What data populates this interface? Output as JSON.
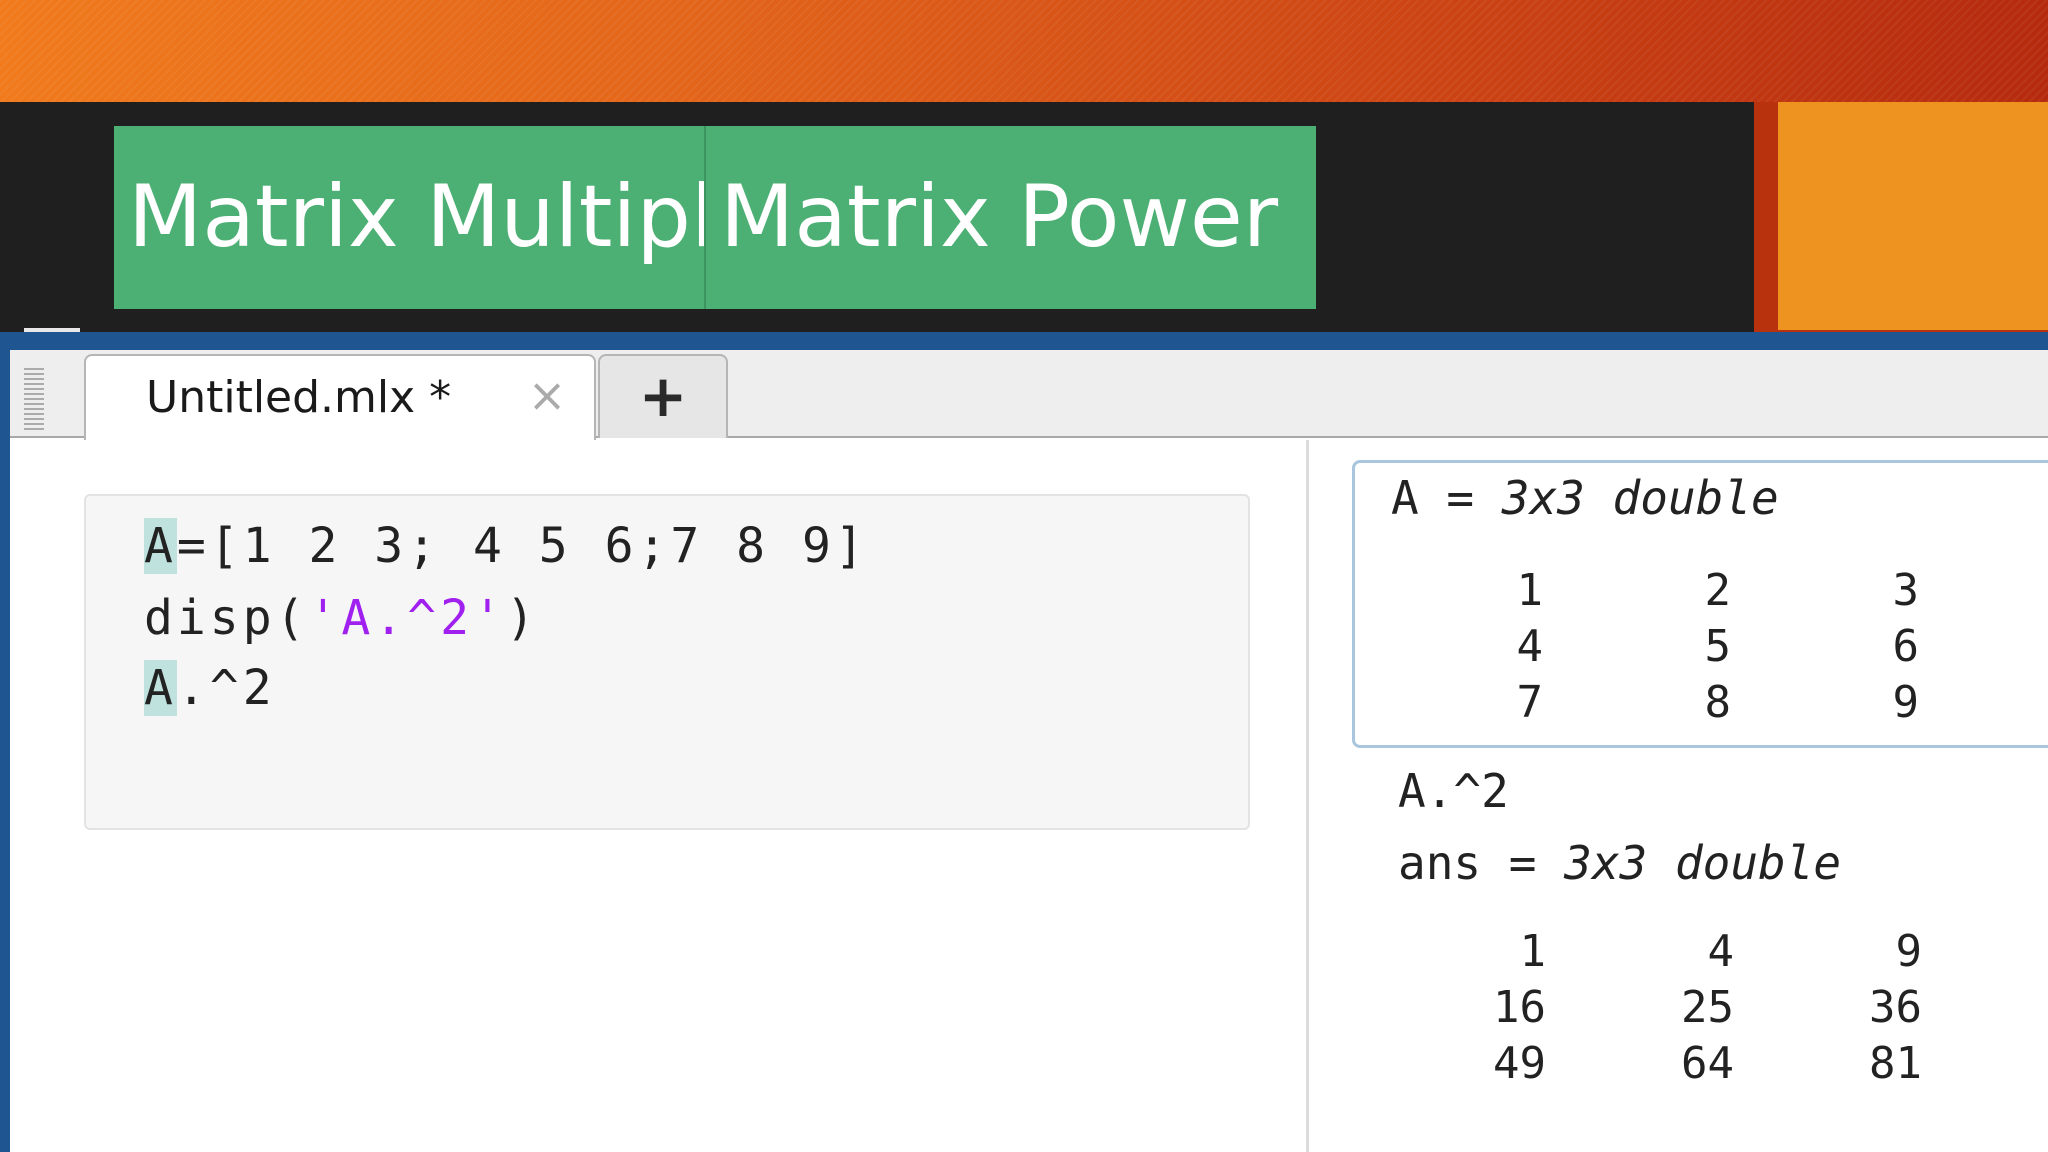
{
  "slide": {
    "title_left": "Matrix Multipl",
    "title_right": "Matrix Power",
    "accent_colors": {
      "orange": "#f07a1c",
      "green": "#4caf74",
      "blue": "#1f5590"
    }
  },
  "editor": {
    "tab_label": "Untitled.mlx *",
    "close_icon": "×",
    "new_tab_icon": "+",
    "code": {
      "line1_var": "A",
      "line1_rest": "=[1 2 3; 4 5 6;7 8 9]",
      "line2_fn": "disp(",
      "line2_str": "'A.^2'",
      "line2_end": ")",
      "line3_var": "A",
      "line3_rest": ".^2"
    }
  },
  "output": {
    "a_label": "A = ",
    "a_type": "3x3 double",
    "a_matrix": [
      "1",
      "2",
      "3",
      "4",
      "5",
      "6",
      "7",
      "8",
      "9"
    ],
    "disp_text": "A.^2",
    "ans_label": "ans = ",
    "ans_type": "3x3 double",
    "ans_matrix": [
      "1",
      "4",
      "9",
      "16",
      "25",
      "36",
      "49",
      "64",
      "81"
    ]
  }
}
